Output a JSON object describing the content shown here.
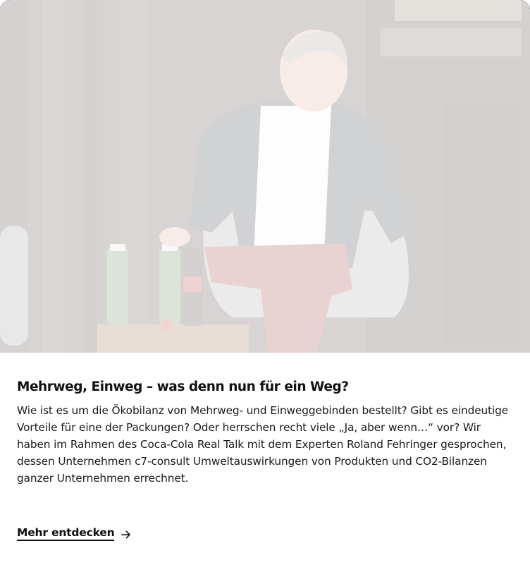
{
  "card": {
    "image_alt": "",
    "title": "Mehrweg, Einweg – was denn nun für ein Weg?",
    "body": "Wie ist es um die Ökobilanz von Mehrweg- und Einweggebinden bestellt? Gibt es eindeutige Vorteile für eine der Packungen? Oder herrschen recht viele „Ja, aber wenn…“ vor? Wir haben im Rahmen des Coca-Cola Real Talk mit dem Experten Roland Fehringer gesprochen, dessen Unternehmen c7-consult Umweltauswirkungen von Produkten und CO2-Bilanzen ganzer Unternehmen errechnet.",
    "cta_label": "Mehr entdecken",
    "cta_icon": "arrow-right-icon"
  },
  "colors": {
    "text": "#111111",
    "background": "#ffffff"
  }
}
